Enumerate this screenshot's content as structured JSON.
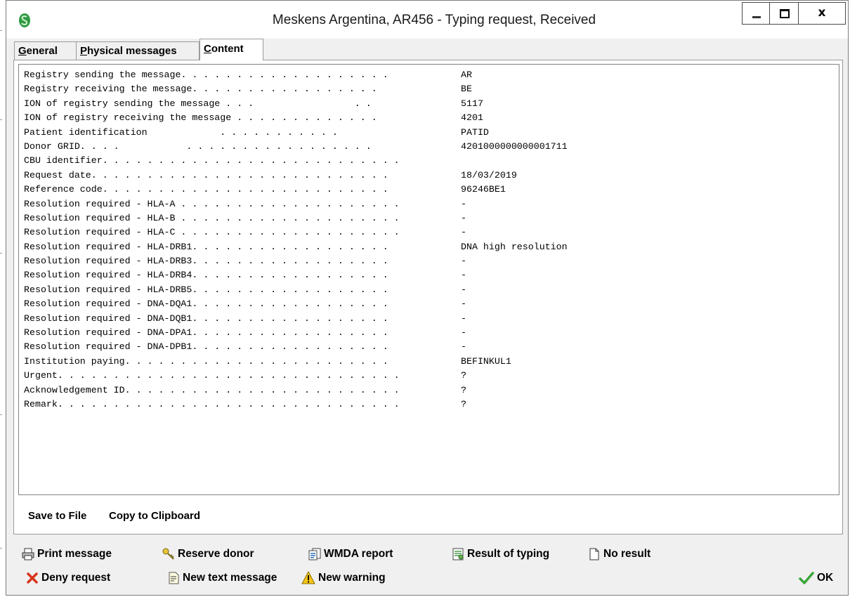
{
  "window": {
    "title": "Meskens Argentina, AR456 - Typing request, Received",
    "minimize_icon": "minimize-icon",
    "maximize_icon": "maximize-icon",
    "close_label": "x"
  },
  "tabs": [
    {
      "accel": "G",
      "rest": "eneral",
      "active": false
    },
    {
      "accel": "P",
      "rest": "hysical messages",
      "active": false
    },
    {
      "accel": "C",
      "rest": "ontent",
      "active": true
    }
  ],
  "content": {
    "rows": [
      {
        "label": "Registry sending the message",
        "dots": ". . . . . . . . . . . . . . . . . . .",
        "value": "AR"
      },
      {
        "label": "Registry receiving the message",
        "dots": ". . . . . . . . . . . . . . . . .",
        "value": "BE"
      },
      {
        "label": "ION of registry sending the message",
        "dots": " . . .                  . .",
        "value": "5117"
      },
      {
        "label": "ION of registry receiving the message",
        "dots": " . . . . . . . . . . . . .",
        "value": "4201"
      },
      {
        "label": "Patient identification",
        "dots": "             . . . . . . . . . . .",
        "value": "PATID"
      },
      {
        "label": "Donor GRID",
        "dots": ". . . .            . . . . . . . . . . . . . . . . .",
        "value": "4201000000000001711"
      },
      {
        "label": "CBU identifier",
        "dots": ". . . . . . . . . . . . . . . . . . . . . . . . . . .",
        "value": ""
      },
      {
        "label": "Request date",
        "dots": ". . . . . . . . . . . . . . . . . . . . . . . . . . .",
        "value": "18/03/2019"
      },
      {
        "label": "Reference code",
        "dots": ". . . . . . . . . . . . . . . . . . . . . . . . . .",
        "value": "96246BE1"
      },
      {
        "label": "Resolution required - HLA-A",
        "dots": " . . . . . . . . . . . . . . . . . . . .",
        "value": "-"
      },
      {
        "label": "Resolution required - HLA-B",
        "dots": " . . . . . . . . . . . . . . . . . . . .",
        "value": "-"
      },
      {
        "label": "Resolution required - HLA-C",
        "dots": " . . . . . . . . . . . . . . . . . . . .",
        "value": "-"
      },
      {
        "label": "Resolution required - HLA-DRB1",
        "dots": ". . . . . . . . . . . . . . . . . .",
        "value": "DNA high resolution"
      },
      {
        "label": "Resolution required - HLA-DRB3",
        "dots": ". . . . . . . . . . . . . . . . . .",
        "value": "-"
      },
      {
        "label": "Resolution required - HLA-DRB4",
        "dots": ". . . . . . . . . . . . . . . . . .",
        "value": "-"
      },
      {
        "label": "Resolution required - HLA-DRB5",
        "dots": ". . . . . . . . . . . . . . . . . .",
        "value": "-"
      },
      {
        "label": "Resolution required - DNA-DQA1",
        "dots": ". . . . . . . . . . . . . . . . . .",
        "value": "-"
      },
      {
        "label": "Resolution required - DNA-DQB1",
        "dots": ". . . . . . . . . . . . . . . . . .",
        "value": "-"
      },
      {
        "label": "Resolution required - DNA-DPA1",
        "dots": ". . . . . . . . . . . . . . . . . .",
        "value": "-"
      },
      {
        "label": "Resolution required - DNA-DPB1",
        "dots": ". . . . . . . . . . . . . . . . . .",
        "value": "-"
      },
      {
        "label": "Institution paying",
        "dots": ". . . . . . . . . . . . . . . . . . . . . . . .",
        "value": "BEFINKUL1"
      },
      {
        "label": "Urgent",
        "dots": ". . . . . . . . . . . . . . . . . . . . . . . . . . . . . . .",
        "value": "?"
      },
      {
        "label": "Acknowledgement ID",
        "dots": ". . . . . . . . . . . . . . . . . . . . . . . . .",
        "value": "?"
      },
      {
        "label": "Remark",
        "dots": ". . . . . . . . . . . . . . . . . . . . . . . . . . . . . . .",
        "value": "?"
      }
    ]
  },
  "links": {
    "save_to_file": "Save to File",
    "copy_to_clipboard": "Copy to Clipboard"
  },
  "actions": {
    "print_message": {
      "label": "Print message",
      "icon": "printer-icon"
    },
    "reserve_donor": {
      "label": "Reserve donor",
      "icon": "key-icon"
    },
    "wmda_report": {
      "label": "WMDA report",
      "icon": "report-icon"
    },
    "result_of_typing": {
      "label": "Result of typing",
      "icon": "typing-result-icon"
    },
    "no_result": {
      "label": "No result",
      "icon": "blank-document-icon"
    },
    "deny_request": {
      "label": "Deny request",
      "icon": "red-x-icon"
    },
    "new_text_message": {
      "label": "New text message",
      "icon": "text-message-icon"
    },
    "new_warning": {
      "label": "New warning",
      "icon": "warning-icon"
    },
    "ok": {
      "label": "OK",
      "icon": "checkmark-icon"
    }
  },
  "colors": {
    "window_bg": "#f0f0f0",
    "content_bg": "#ffffff",
    "deny_icon": "#d9341f",
    "ok_icon": "#3aa63a",
    "warning_icon": "#f5c518",
    "app_icon": "#2e9a43"
  }
}
